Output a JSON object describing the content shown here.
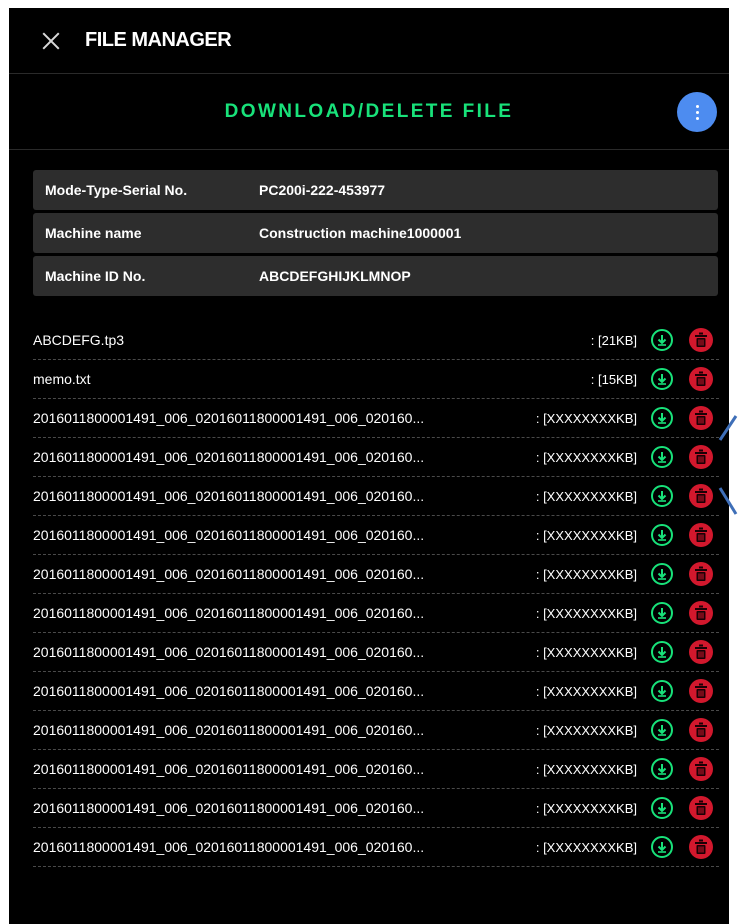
{
  "header": {
    "title": "FILE MANAGER",
    "close_icon": "close-icon"
  },
  "subheader": {
    "title": "DOWNLOAD/DELETE FILE",
    "menu_icon": "more-vertical-icon"
  },
  "colors": {
    "accent_green": "#18e27a",
    "menu_blue": "#4d8cf0",
    "delete_red": "#d2182d",
    "background": "#000000",
    "row_background": "#2d2d2d"
  },
  "info": [
    {
      "label": "Mode-Type-Serial No.",
      "value": "PC200i-222-453977"
    },
    {
      "label": "Machine name",
      "value": "Construction machine1000001"
    },
    {
      "label": "Machine ID No.",
      "value": "ABCDEFGHIJKLMNOP"
    }
  ],
  "files": [
    {
      "name": "ABCDEFG.tp3",
      "size": ": [21KB]"
    },
    {
      "name": "memo.txt",
      "size": ": [15KB]"
    },
    {
      "name": "2016011800001491_006_02016011800001491_006_020160...",
      "size": ": [XXXXXXXXKB]"
    },
    {
      "name": "2016011800001491_006_02016011800001491_006_020160...",
      "size": ": [XXXXXXXXKB]"
    },
    {
      "name": "2016011800001491_006_02016011800001491_006_020160...",
      "size": ": [XXXXXXXXKB]"
    },
    {
      "name": "2016011800001491_006_02016011800001491_006_020160...",
      "size": ": [XXXXXXXXKB]"
    },
    {
      "name": "2016011800001491_006_02016011800001491_006_020160...",
      "size": ": [XXXXXXXXKB]"
    },
    {
      "name": "2016011800001491_006_02016011800001491_006_020160...",
      "size": ": [XXXXXXXXKB]"
    },
    {
      "name": "2016011800001491_006_02016011800001491_006_020160...",
      "size": ": [XXXXXXXXKB]"
    },
    {
      "name": "2016011800001491_006_02016011800001491_006_020160...",
      "size": ": [XXXXXXXXKB]"
    },
    {
      "name": "2016011800001491_006_02016011800001491_006_020160...",
      "size": ": [XXXXXXXXKB]"
    },
    {
      "name": "2016011800001491_006_02016011800001491_006_020160...",
      "size": ": [XXXXXXXXKB]"
    },
    {
      "name": "2016011800001491_006_02016011800001491_006_020160...",
      "size": ": [XXXXXXXXKB]"
    },
    {
      "name": "2016011800001491_006_02016011800001491_006_020160...",
      "size": ": [XXXXXXXXKB]"
    }
  ],
  "row_icons": {
    "download": "download-icon",
    "delete": "trash-icon"
  }
}
